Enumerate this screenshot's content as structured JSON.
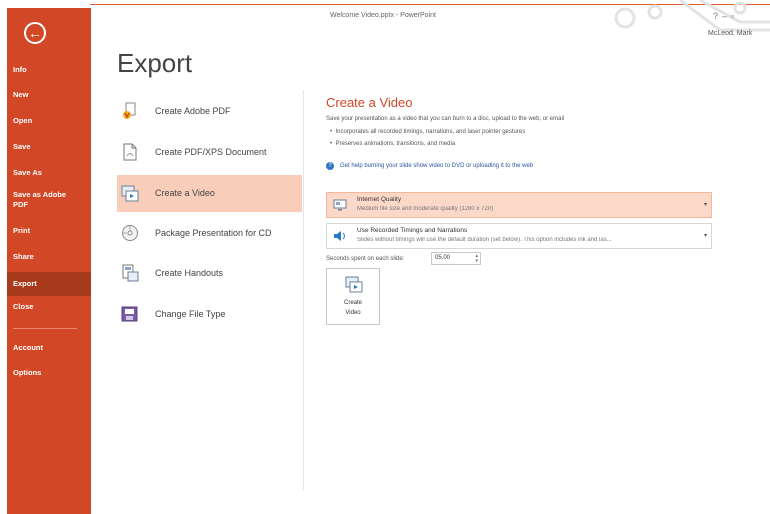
{
  "window": {
    "title": "Welcome Video.pptx - PowerPoint",
    "user": "McLeod, Mark",
    "controls": [
      "?",
      "–",
      "▫"
    ]
  },
  "sidebar": {
    "back_label": "←",
    "items": [
      {
        "label": "Info"
      },
      {
        "label": "New"
      },
      {
        "label": "Open"
      },
      {
        "label": "Save"
      },
      {
        "label": "Save As"
      },
      {
        "label": "Save as Adobe PDF"
      },
      {
        "label": "Print"
      },
      {
        "label": "Share"
      },
      {
        "label": "Export"
      },
      {
        "label": "Close"
      },
      {
        "label": "Account"
      },
      {
        "label": "Options"
      }
    ],
    "active": "Export"
  },
  "page_title": "Export",
  "export_options": [
    {
      "label": "Create Adobe PDF",
      "icon": "adobe-pdf-icon"
    },
    {
      "label": "Create PDF/XPS Document",
      "icon": "pdf-xps-document-icon"
    },
    {
      "label": "Create a Video",
      "icon": "create-video-icon"
    },
    {
      "label": "Package Presentation for CD",
      "icon": "cd-package-icon"
    },
    {
      "label": "Create Handouts",
      "icon": "handouts-icon"
    },
    {
      "label": "Change File Type",
      "icon": "change-file-type-icon"
    }
  ],
  "selected_option": "Create a Video",
  "video": {
    "heading": "Create a Video",
    "description": "Save your presentation as a video that you can burn to a disc, upload to the web, or email",
    "bullets": [
      "Incorporates all recorded timings, narrations, and laser pointer gestures",
      "Preserves animations, transitions, and media"
    ],
    "help_link": "Get help burning your slide show video to DVD or uploading it to the web",
    "quality": {
      "title": "Internet Quality",
      "subtitle": "Medium file size and moderate quality (1280 x 720)"
    },
    "timings": {
      "title": "Use Recorded Timings and Narrations",
      "subtitle": "Slides without timings will use the default duration (set below). This option includes ink and las..."
    },
    "seconds_label": "Seconds spent on each slide:",
    "seconds_value": "05.00",
    "create_button": [
      "Create",
      "Video"
    ]
  },
  "colors": {
    "accent": "#d24726",
    "sidebar_active": "#a83a1c",
    "selection": "#f8cdb9"
  }
}
